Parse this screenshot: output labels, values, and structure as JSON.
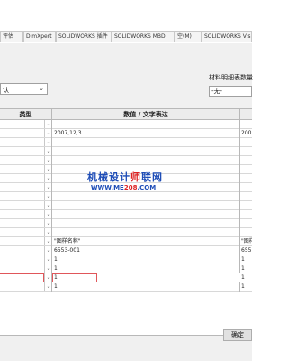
{
  "tabs": [
    "评估",
    "DimXpert",
    "SOLIDWORKS 插件",
    "SOLIDWORKS MBD",
    "空(M)",
    "SOLIDWORKS Vis"
  ],
  "dropdown": {
    "value": "认"
  },
  "bom_label": "材料明细表数量",
  "bom_value": "-无-",
  "grid": {
    "header_type": "类型",
    "header_value": "数值 / 文字表达",
    "rows": [
      {
        "val": "",
        "last": ""
      },
      {
        "val": "2007,12,3",
        "last": "200"
      },
      {
        "val": "",
        "last": ""
      },
      {
        "val": "",
        "last": ""
      },
      {
        "val": "",
        "last": ""
      },
      {
        "val": "",
        "last": ""
      },
      {
        "val": "",
        "last": ""
      },
      {
        "val": "",
        "last": ""
      },
      {
        "val": "",
        "last": ""
      },
      {
        "val": "",
        "last": ""
      },
      {
        "val": "",
        "last": ""
      },
      {
        "val": "",
        "last": ""
      },
      {
        "val": "",
        "last": ""
      },
      {
        "val": "\"图样名称\"",
        "last": "\"图样"
      },
      {
        "val": "6553-001",
        "last": "655"
      },
      {
        "val": "1",
        "last": "1"
      },
      {
        "val": "1",
        "last": "1"
      },
      {
        "val": "1",
        "last": "1"
      },
      {
        "val": "1",
        "last": "1"
      }
    ]
  },
  "watermark": {
    "main_blue": "机械设计",
    "main_red": "师",
    "main_blue2": "联网",
    "sub_blue": "WWW.ME",
    "sub_red": "208",
    "sub_blue2": ".COM"
  },
  "ok_label": "确定"
}
